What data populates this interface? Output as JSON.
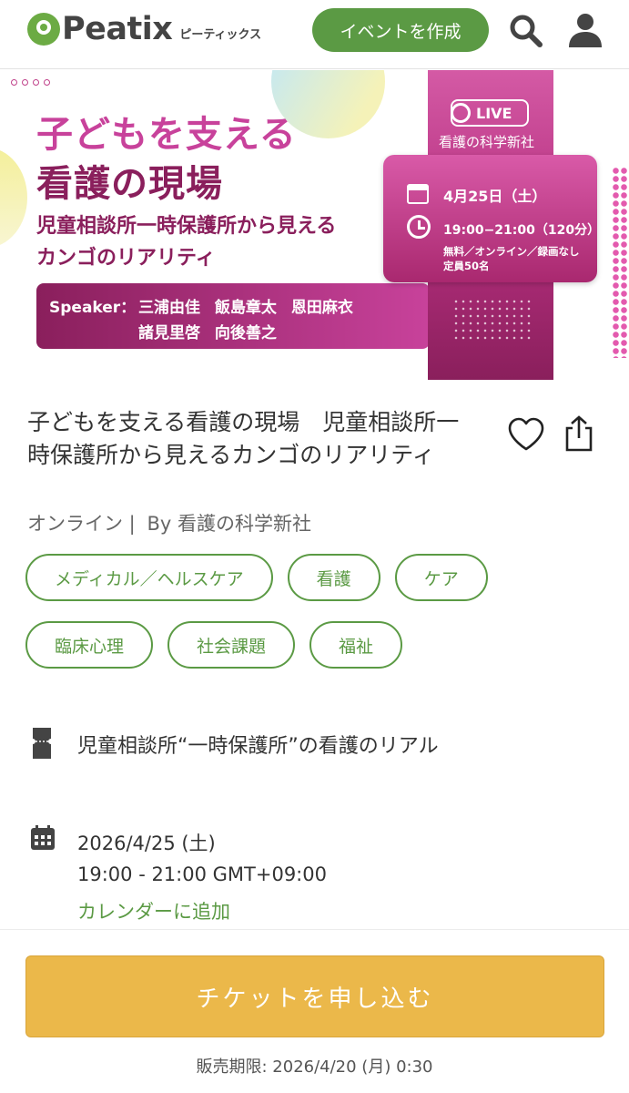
{
  "header": {
    "logo_text": "Peatix",
    "logo_sub": "ピーティックス",
    "create_event_label": "イベントを作成",
    "search_icon": "search-icon",
    "user_icon": "user-icon"
  },
  "banner": {
    "title_line1": "子どもを支える",
    "title_line2": "看護の現場",
    "subtitle_line1": "児童相談所一時保護所から見える",
    "subtitle_line2": "カンゴのリアリティ",
    "speaker_label": "Speaker：",
    "speakers_row1": "三浦由佳 飯島章太 恩田麻衣",
    "speakers_row2": "諸見里啓 向後善之",
    "live_label": "LIVE",
    "publisher": "看護の科学新社",
    "card_date": "4月25日（土）",
    "card_time": "19:00−21:00（120分）",
    "card_note1": "無料／オンライン／録画なし",
    "card_note2": "定員50名",
    "colors": {
      "pink": "#c8429b",
      "plum": "#8a1f5c"
    }
  },
  "event": {
    "title": "子どもを支える看護の現場　児童相談所一時保護所から見えるカンゴのリアリティ",
    "location": "オンライン |",
    "organizer": "By 看護の科学新社",
    "tags": [
      "メディカル／ヘルスケア",
      "看護",
      "ケア",
      "臨床心理",
      "社会課題",
      "福祉"
    ],
    "ticket_name": "児童相談所“一時保護所”の看護のリアル",
    "date": "2026/4/25 (土)",
    "time": "19:00 - 21:00 GMT+09:00",
    "add_calendar": "カレンダーに追加"
  },
  "footer": {
    "apply_label": "チケットを申し込む",
    "deadline": "販売期限: 2026/4/20 (月) 0:30"
  },
  "colors": {
    "brand_green": "#5b9a44",
    "apply_yellow": "#ebb84a"
  }
}
